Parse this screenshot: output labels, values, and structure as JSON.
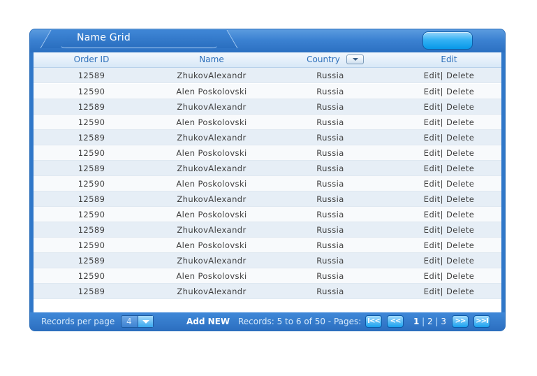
{
  "header": {
    "title": "Name Grid"
  },
  "columns": {
    "order_id": "Order ID",
    "name": "Name",
    "country": "Country",
    "edit": "Edit"
  },
  "rows": [
    {
      "order_id": "12589",
      "name": "ZhukovAlexandr",
      "country": "Russia",
      "edit": "Edit",
      "delete": "Delete"
    },
    {
      "order_id": "12590",
      "name": "Alen Poskolovski",
      "country": "Russia",
      "edit": "Edit",
      "delete": "Delete"
    },
    {
      "order_id": "12589",
      "name": "ZhukovAlexandr",
      "country": "Russia",
      "edit": "Edit",
      "delete": "Delete"
    },
    {
      "order_id": "12590",
      "name": "Alen Poskolovski",
      "country": "Russia",
      "edit": "Edit",
      "delete": "Delete"
    },
    {
      "order_id": "12589",
      "name": "ZhukovAlexandr",
      "country": "Russia",
      "edit": "Edit",
      "delete": "Delete"
    },
    {
      "order_id": "12590",
      "name": "Alen Poskolovski",
      "country": "Russia",
      "edit": "Edit",
      "delete": "Delete"
    },
    {
      "order_id": "12589",
      "name": "ZhukovAlexandr",
      "country": "Russia",
      "edit": "Edit",
      "delete": "Delete"
    },
    {
      "order_id": "12590",
      "name": "Alen Poskolovski",
      "country": "Russia",
      "edit": "Edit",
      "delete": "Delete"
    },
    {
      "order_id": "12589",
      "name": "ZhukovAlexandr",
      "country": "Russia",
      "edit": "Edit",
      "delete": "Delete"
    },
    {
      "order_id": "12590",
      "name": "Alen Poskolovski",
      "country": "Russia",
      "edit": "Edit",
      "delete": "Delete"
    },
    {
      "order_id": "12589",
      "name": "ZhukovAlexandr",
      "country": "Russia",
      "edit": "Edit",
      "delete": "Delete"
    },
    {
      "order_id": "12590",
      "name": "Alen Poskolovski",
      "country": "Russia",
      "edit": "Edit",
      "delete": "Delete"
    },
    {
      "order_id": "12589",
      "name": "ZhukovAlexandr",
      "country": "Russia",
      "edit": "Edit",
      "delete": "Delete"
    },
    {
      "order_id": "12590",
      "name": "Alen Poskolovski",
      "country": "Russia",
      "edit": "Edit",
      "delete": "Delete"
    },
    {
      "order_id": "12589",
      "name": "ZhukovAlexandr",
      "country": "Russia",
      "edit": "Edit",
      "delete": "Delete"
    }
  ],
  "footer": {
    "records_per_page_label": "Records per page",
    "records_per_page_value": "4",
    "add_new_label": "Add NEW",
    "records_info": "Records: 5 to 6 of 50 - Pages:",
    "pages": [
      "1",
      "2",
      "3"
    ],
    "current_page": "1",
    "first_label": "I<<",
    "prev_label": "<<",
    "next_label": ">>",
    "last_label": ">>I"
  },
  "colors": {
    "accent": "#2f77c9",
    "header_text": "#2c6fba",
    "button": "#1aa1ef"
  },
  "icons": {
    "sort": "chevron-down-icon",
    "select": "chevron-down-icon"
  }
}
